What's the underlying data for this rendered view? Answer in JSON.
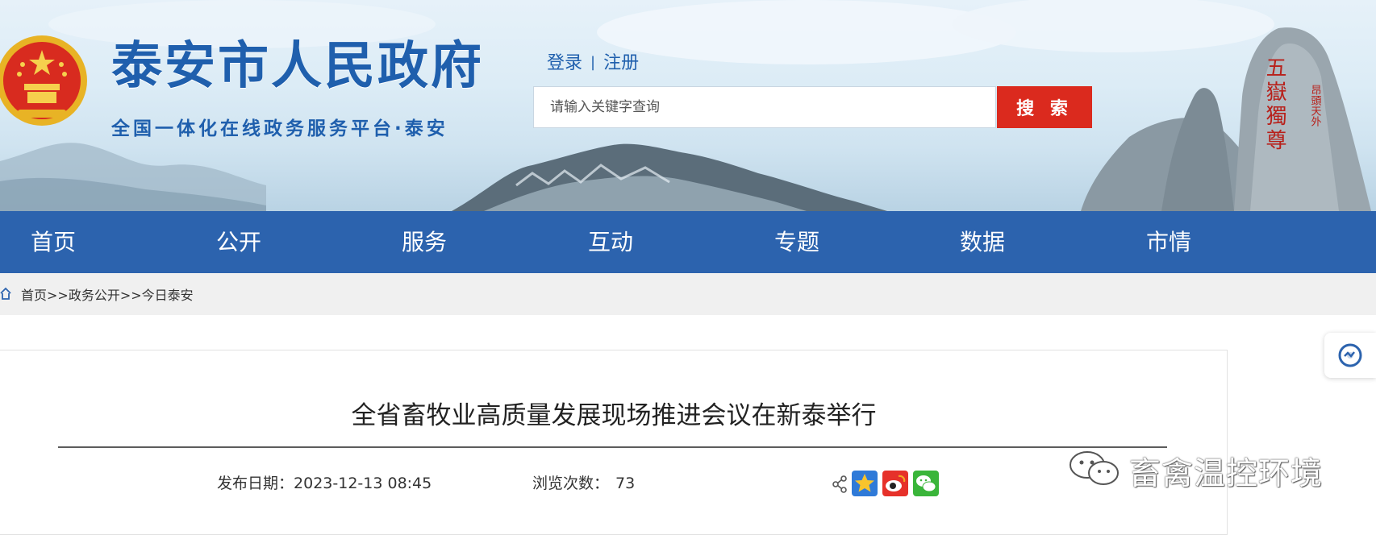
{
  "site": {
    "title": "泰安市人民政府",
    "subtitle": "全国一体化在线政务服务平台·泰安",
    "mountain_inscription": "五嶽獨尊",
    "mountain_inscription_small": "昂頭天外"
  },
  "auth": {
    "login_label": "登录",
    "separator": "|",
    "register_label": "注册"
  },
  "search": {
    "placeholder": "请输入关键字查询",
    "button_label": "搜 索"
  },
  "nav": {
    "items": [
      {
        "label": "首页"
      },
      {
        "label": "公开"
      },
      {
        "label": "服务"
      },
      {
        "label": "互动"
      },
      {
        "label": "专题"
      },
      {
        "label": "数据"
      },
      {
        "label": "市情"
      }
    ]
  },
  "breadcrumb": {
    "text": "首页>>政务公开>>今日泰安"
  },
  "article": {
    "title": "全省畜牧业高质量发展现场推进会议在新泰举行",
    "publish_label": "发布日期：",
    "publish_date": "2023-12-13 08:45",
    "views_label": "浏览次数：",
    "views_count": "73"
  },
  "share": {
    "icons": [
      "share-icon",
      "qzone-icon",
      "weibo-icon",
      "wechat-icon"
    ]
  },
  "float_button": {
    "icon": "assistant-icon"
  },
  "watermark": {
    "text": "畜禽温控环境",
    "icon": "wechat-logo-icon"
  },
  "colors": {
    "brand_blue": "#2c63ae",
    "title_blue": "#1f5fad",
    "search_red": "#db2a1e",
    "breadcrumb_bg": "#f0f0f0"
  }
}
